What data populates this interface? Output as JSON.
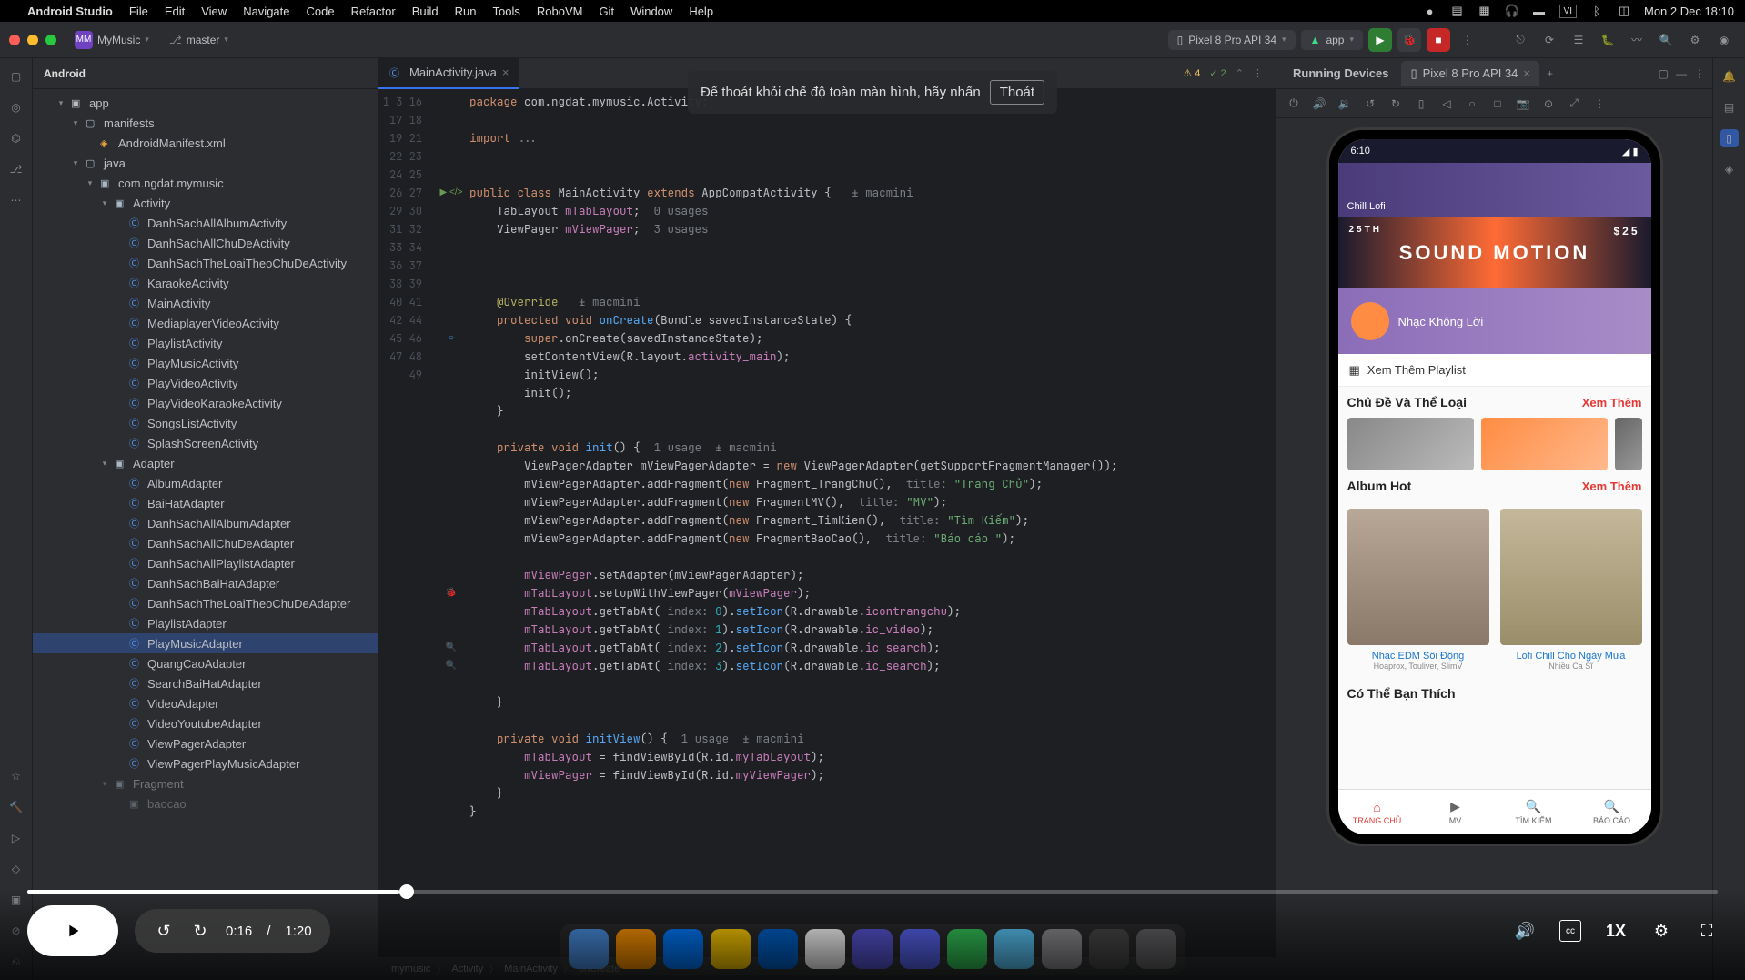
{
  "menubar": {
    "app": "Android Studio",
    "items": [
      "File",
      "Edit",
      "View",
      "Navigate",
      "Code",
      "Refactor",
      "Build",
      "Run",
      "Tools",
      "RoboVM",
      "Git",
      "Window",
      "Help"
    ],
    "lang": "VI",
    "clock": "Mon 2 Dec 18:10"
  },
  "project": {
    "badge": "MM",
    "name": "MyMusic",
    "branch": "master"
  },
  "runTargets": {
    "device": "Pixel 8 Pro API 34",
    "config": "app"
  },
  "panel": {
    "title": "Android"
  },
  "tree": {
    "app": "app",
    "manifests": "manifests",
    "manifestFile": "AndroidManifest.xml",
    "java": "java",
    "pkg": "com.ngdat.mymusic",
    "activityPkg": "Activity",
    "activities": [
      "DanhSachAllAlbumActivity",
      "DanhSachAllChuDeActivity",
      "DanhSachTheLoaiTheoChuDeActivity",
      "KaraokeActivity",
      "MainActivity",
      "MediaplayerVideoActivity",
      "PlaylistActivity",
      "PlayMusicActivity",
      "PlayVideoActivity",
      "PlayVideoKaraokeActivity",
      "SongsListActivity",
      "SplashScreenActivity"
    ],
    "adapterPkg": "Adapter",
    "adapters": [
      "AlbumAdapter",
      "BaiHatAdapter",
      "DanhSachAllAlbumAdapter",
      "DanhSachAllChuDeAdapter",
      "DanhSachAllPlaylistAdapter",
      "DanhSachBaiHatAdapter",
      "DanhSachTheLoaiTheoChuDeAdapter",
      "PlaylistAdapter",
      "PlayMusicAdapter",
      "QuangCaoAdapter",
      "SearchBaiHatAdapter",
      "VideoAdapter",
      "VideoYoutubeAdapter",
      "ViewPagerAdapter",
      "ViewPagerPlayMusicAdapter"
    ],
    "fragmentPkg": "Fragment",
    "baocao": "baocao"
  },
  "editor": {
    "tab": "MainActivity.java",
    "warnCount": "4",
    "checkCount": "2",
    "lines": [
      "1",
      "",
      "3",
      "",
      "",
      "16",
      "17",
      "18",
      "19",
      "",
      "",
      "21",
      "22",
      "23",
      "24",
      "25",
      "26",
      "27",
      "",
      "29",
      "30",
      "31",
      "32",
      "33",
      "34",
      "",
      "36",
      "37",
      "38",
      "39",
      "40",
      "41",
      "42",
      "",
      "44",
      "45",
      "46",
      "47",
      "48",
      "49"
    ],
    "author1": "macmini",
    "author2": "macmini",
    "usages0": "0 usages",
    "usages3": "3 usages",
    "usage1": "1 usage",
    "crumbs": [
      "mymusic",
      "Activity",
      "MainActivity",
      "onCreate"
    ]
  },
  "hint": {
    "text": "Để thoát khỏi chế độ toàn màn hình, hãy nhấn",
    "btn": "Thoát"
  },
  "devices": {
    "title": "Running Devices",
    "tab": "Pixel 8 Pro API 34"
  },
  "phone": {
    "time": "6:10",
    "chillLabel": "Chill Lofi",
    "sound": "SOUND MOTION",
    "date25": "25TH",
    "price25": "$25",
    "nolyric": "Nhạc Không Lời",
    "morePlaylist": "Xem Thêm Playlist",
    "sect1": "Chủ Đề Và Thể Loại",
    "sect2": "Album Hot",
    "sect3": "Có Thể Bạn Thích",
    "more": "Xem Thêm",
    "album1": "Nhạc EDM Sôi Động",
    "album1sub": "Hoaprox, Touliver, SlimV",
    "album2": "Lofi Chill Cho Ngày Mưa",
    "album2sub": "Nhiều Ca Sĩ",
    "nav": [
      "TRANG CHỦ",
      "MV",
      "TÌM KIẾM",
      "BÁO CÁO"
    ]
  },
  "video": {
    "current": "0:16",
    "duration": "1:20",
    "speed": "1X"
  }
}
